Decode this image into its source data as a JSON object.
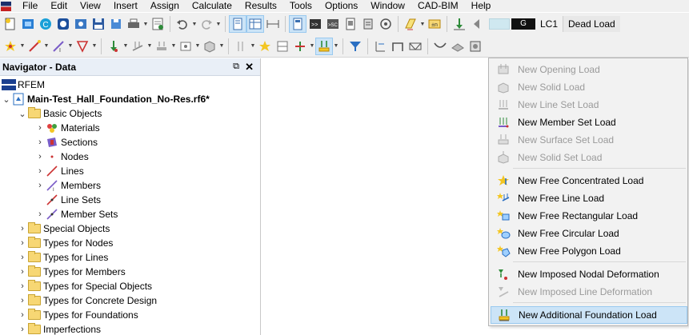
{
  "menubar": {
    "items": [
      "File",
      "Edit",
      "View",
      "Insert",
      "Assign",
      "Calculate",
      "Results",
      "Tools",
      "Options",
      "Window",
      "CAD-BIM",
      "Help"
    ]
  },
  "toolbar": {
    "load_case_color": "#cfe8f0",
    "load_case_badge": "G",
    "load_case_number": "LC1",
    "load_case_name": "Dead Load"
  },
  "navigator": {
    "title": "Navigator - Data",
    "root": "RFEM",
    "file": "Main-Test_Hall_Foundation_No-Res.rf6*",
    "basic_objects": "Basic Objects",
    "basic_children": [
      "Materials",
      "Sections",
      "Nodes",
      "Lines",
      "Members",
      "Line Sets",
      "Member Sets"
    ],
    "folders": [
      "Special Objects",
      "Types for Nodes",
      "Types for Lines",
      "Types for Members",
      "Types for Special Objects",
      "Types for Concrete Design",
      "Types for Foundations",
      "Imperfections"
    ]
  },
  "dropdown_menu": {
    "items": [
      {
        "label": "New Opening Load",
        "enabled": false,
        "icon": "opening-load-icon"
      },
      {
        "label": "New Solid Load",
        "enabled": false,
        "icon": "solid-load-icon"
      },
      {
        "label": "New Line Set Load",
        "enabled": false,
        "icon": "line-set-load-icon"
      },
      {
        "label": "New Member Set Load",
        "enabled": true,
        "icon": "member-set-load-icon"
      },
      {
        "label": "New Surface Set Load",
        "enabled": false,
        "icon": "surface-set-load-icon"
      },
      {
        "label": "New Solid Set Load",
        "enabled": false,
        "icon": "solid-set-load-icon"
      },
      {
        "label": "New Free Concentrated Load",
        "enabled": true,
        "icon": "free-concentrated-load-icon"
      },
      {
        "label": "New Free Line Load",
        "enabled": true,
        "icon": "free-line-load-icon"
      },
      {
        "label": "New Free Rectangular Load",
        "enabled": true,
        "icon": "free-rectangular-load-icon"
      },
      {
        "label": "New Free Circular Load",
        "enabled": true,
        "icon": "free-circular-load-icon"
      },
      {
        "label": "New Free Polygon Load",
        "enabled": true,
        "icon": "free-polygon-load-icon"
      },
      {
        "label": "New Imposed Nodal Deformation",
        "enabled": true,
        "icon": "imposed-nodal-deformation-icon"
      },
      {
        "label": "New Imposed Line Deformation",
        "enabled": false,
        "icon": "imposed-line-deformation-icon"
      },
      {
        "label": "New Additional Foundation Load",
        "enabled": true,
        "highlighted": true,
        "icon": "additional-foundation-load-icon"
      }
    ]
  }
}
